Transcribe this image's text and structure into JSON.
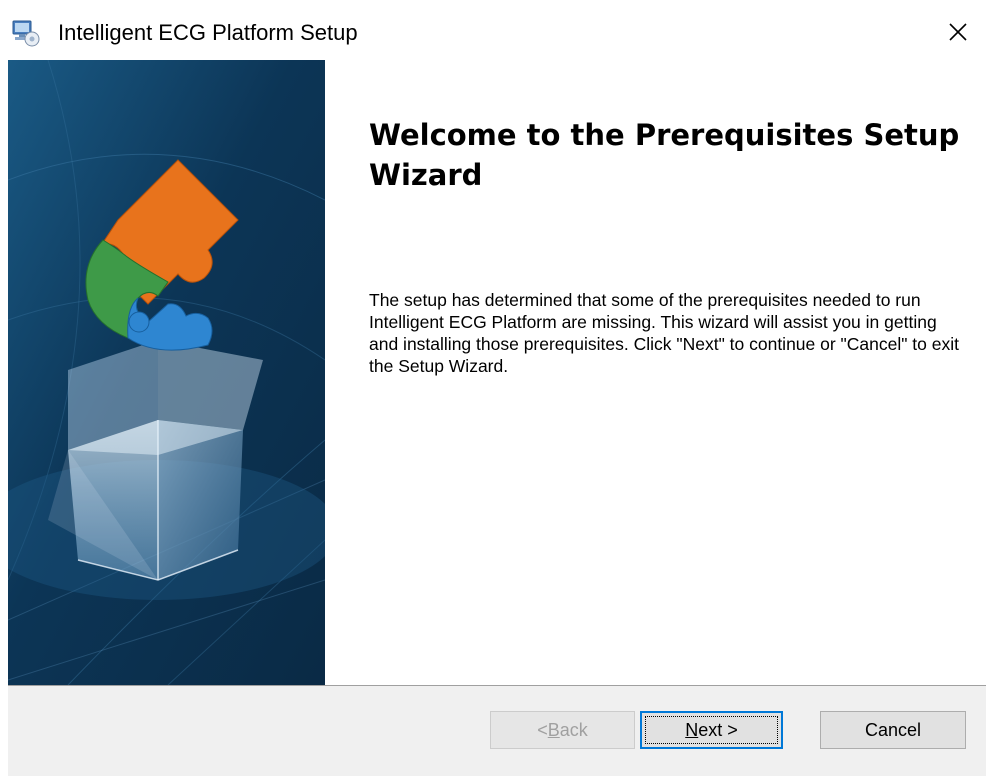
{
  "window": {
    "title": "Intelligent ECG Platform Setup",
    "icon": "setup-computer-icon",
    "close_glyph": "✕"
  },
  "banner": {
    "image": "puzzle-box-graphic",
    "colors": {
      "background": "#0e3a5c",
      "puzzle_orange": "#e8731c",
      "puzzle_green": "#3e9a48",
      "puzzle_blue": "#2e86d1"
    }
  },
  "content": {
    "heading": "Welcome to the Prerequisites Setup Wizard",
    "body": "The setup has determined that some of the prerequisites needed to run Intelligent ECG Platform are missing. This wizard will assist you in getting and installing those prerequisites. Click \"Next\" to continue or \"Cancel\" to exit the Setup Wizard."
  },
  "buttons": {
    "back": {
      "prefix": "< ",
      "mnemonic": "B",
      "rest": "ack",
      "enabled": false
    },
    "next": {
      "mnemonic": "N",
      "rest": "ext >",
      "enabled": true,
      "focused": true
    },
    "cancel": {
      "label": "Cancel",
      "enabled": true
    }
  },
  "colors": {
    "focus_border": "#0078d7",
    "footer_bg": "#f0f0f0",
    "disabled_text": "#a0a0a0"
  }
}
